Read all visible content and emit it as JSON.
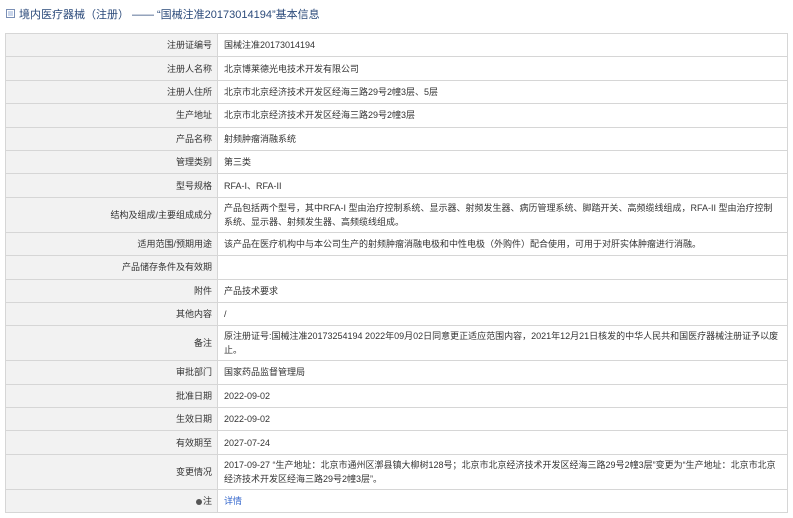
{
  "title": {
    "category": "境内医疗器械（注册）",
    "separator": "——",
    "record": "“国械注准20173014194”基本信息"
  },
  "rows": [
    {
      "label": "注册证编号",
      "value": "国械注准20173014194"
    },
    {
      "label": "注册人名称",
      "value": "北京博莱德光电技术开发有限公司"
    },
    {
      "label": "注册人住所",
      "value": "北京市北京经济技术开发区经海三路29号2幢3层、5层"
    },
    {
      "label": "生产地址",
      "value": "北京市北京经济技术开发区经海三路29号2幢3层"
    },
    {
      "label": "产品名称",
      "value": "射频肿瘤消融系统"
    },
    {
      "label": "管理类别",
      "value": "第三类"
    },
    {
      "label": "型号规格",
      "value": "RFA-I、RFA-II"
    },
    {
      "label": "结构及组成/主要组成成分",
      "value": "产品包括两个型号，其中RFA-I 型由治疗控制系统、显示器、射频发生器、病历管理系统、脚踏开关、高频缆线组成，RFA-II 型由治疗控制系统、显示器、射频发生器、高频缆线组成。"
    },
    {
      "label": "适用范围/预期用途",
      "value": "该产品在医疗机构中与本公司生产的射频肿瘤消融电极和中性电极（外购件）配合使用，可用于对肝实体肿瘤进行消融。"
    },
    {
      "label": "产品储存条件及有效期",
      "value": ""
    },
    {
      "label": "附件",
      "value": "产品技术要求"
    },
    {
      "label": "其他内容",
      "value": "/"
    },
    {
      "label": "备注",
      "value": "原注册证号:国械注准20173254194 2022年09月02日同意更正适应范围内容，2021年12月21日核发的中华人民共和国医疗器械注册证予以废止。"
    },
    {
      "label": "审批部门",
      "value": "国家药品监督管理局"
    },
    {
      "label": "批准日期",
      "value": "2022-09-02"
    },
    {
      "label": "生效日期",
      "value": "2022-09-02"
    },
    {
      "label": "有效期至",
      "value": "2027-07-24"
    },
    {
      "label": "变更情况",
      "value": "2017-09-27 “生产地址：北京市通州区漷县镇大柳树128号；北京市北京经济技术开发区经海三路29号2幢3层”变更为“生产地址：北京市北京经济技术开发区经海三路29号2幢3层”。"
    },
    {
      "label": "注",
      "value": "详情"
    }
  ]
}
